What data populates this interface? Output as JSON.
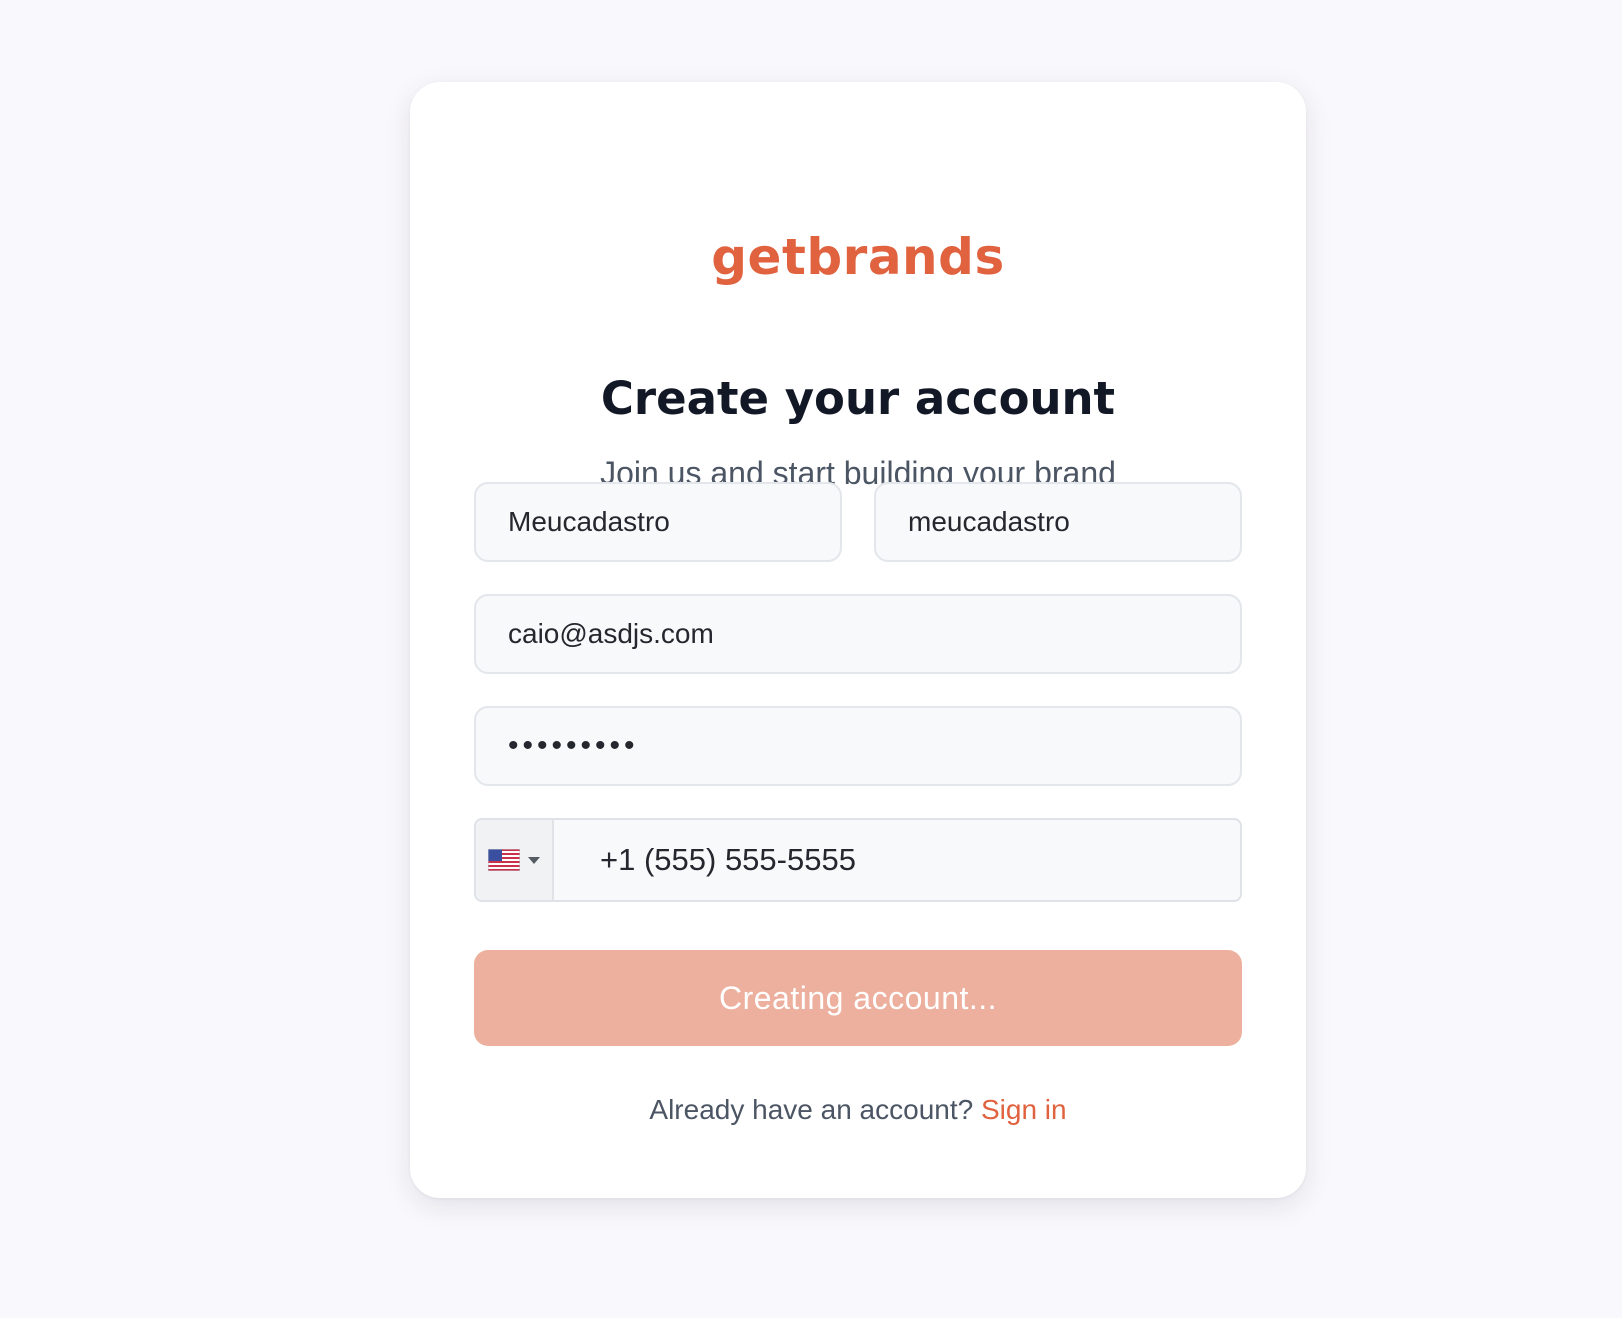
{
  "brand": {
    "name": "getbrands",
    "color": "#e0623f"
  },
  "heading": {
    "title": "Create your account",
    "subtitle": "Join us and start building your brand"
  },
  "form": {
    "first_name_value": "Meucadastro",
    "last_name_value": "meucadastro",
    "email_value": "caio@asdjs.com",
    "password_mask": "•••••••••",
    "phone": {
      "country_flag": "us-flag-icon",
      "value": "+1 (555) 555-5555"
    },
    "submit_label": "Creating account...",
    "submit_color": "#edb09e"
  },
  "footer": {
    "prompt": "Already have an account?",
    "link_label": "Sign in",
    "link_color": "#e0623f"
  }
}
